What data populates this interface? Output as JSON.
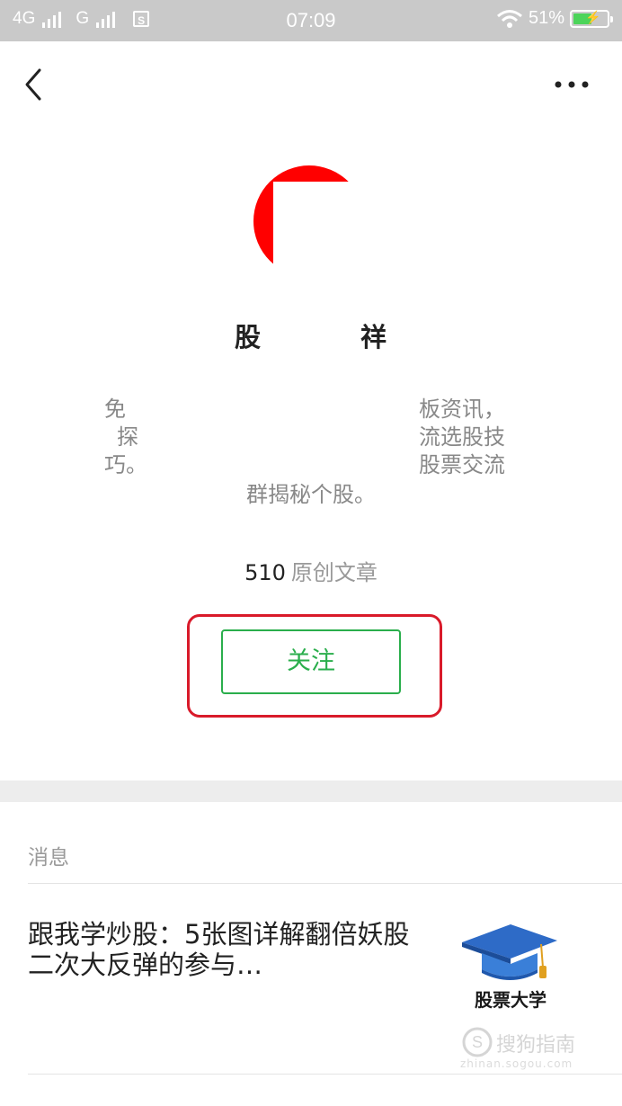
{
  "status_bar": {
    "network_1": "4G",
    "network_2": "G",
    "time": "07:09",
    "battery": "51%",
    "battery_level": 0.51,
    "sim_icon": "S"
  },
  "nav": {
    "back_icon": "chevron-left-icon",
    "more_icon": "more-dots-icon"
  },
  "profile": {
    "avatar_color": "#ff0000",
    "title_start": "股",
    "title_end": "祥",
    "desc_left_lines": [
      "免",
      "探",
      "巧。"
    ],
    "desc_right_lines": [
      "板资讯，",
      "流选股技",
      "股票交流"
    ],
    "desc_center": "群揭秘个股。",
    "article_count": "510",
    "article_label": "原创文章",
    "follow_label": "关注",
    "follow_color": "#2aae4c",
    "highlight_color": "#d91a2a"
  },
  "messages": {
    "section_label": "消息",
    "items": [
      {
        "title": "跟我学炒股：5张图详解翻倍妖股二次大反弹的参与…",
        "thumb_caption": "股票大学"
      }
    ]
  },
  "watermark": {
    "text": "搜狗指南",
    "sub": "zhinan.sogou.com"
  }
}
